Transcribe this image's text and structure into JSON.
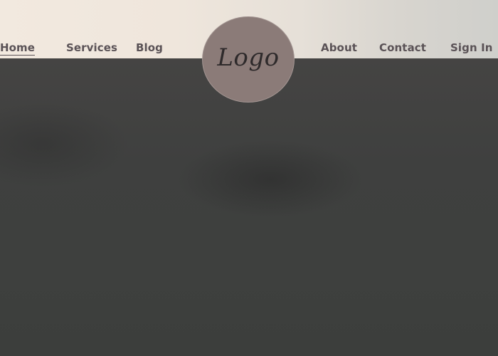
{
  "nav": {
    "left": [
      {
        "label": "Home",
        "active": true
      },
      {
        "label": "Services"
      },
      {
        "label": "Blog"
      }
    ],
    "right": [
      {
        "label": "About"
      },
      {
        "label": "Contact"
      },
      {
        "label": "Sign In"
      }
    ]
  },
  "logo": {
    "text": "Logo"
  },
  "colors": {
    "nav_text": "#5a5256",
    "logo_bg": "#8b7b78",
    "hero_bg": "#3d3f3d"
  }
}
